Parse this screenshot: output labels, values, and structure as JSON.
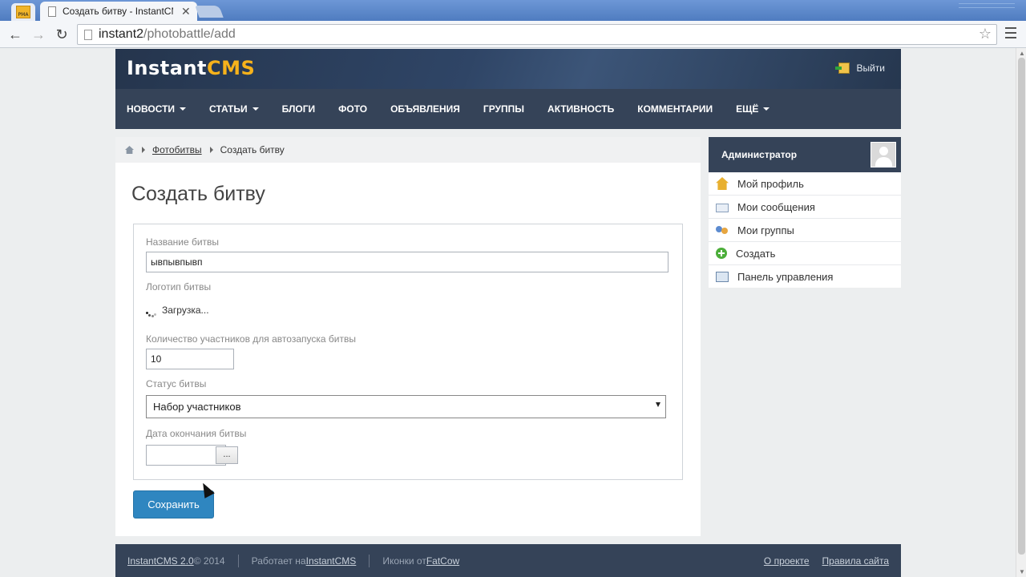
{
  "browser": {
    "tab_title": "Создать битву - InstantCMS",
    "tab_close": "✕",
    "url_host": "instant2",
    "url_path": "/photobattle/add",
    "app_icon_text": "PMA"
  },
  "site": {
    "logo_main": "Instant",
    "logo_accent": "CMS",
    "logout": "Выйти"
  },
  "nav": [
    {
      "label": "НОВОСТИ",
      "dropdown": true
    },
    {
      "label": "СТАТЬИ",
      "dropdown": true
    },
    {
      "label": "БЛОГИ",
      "dropdown": false
    },
    {
      "label": "ФОТО",
      "dropdown": false
    },
    {
      "label": "ОБЪЯВЛЕНИЯ",
      "dropdown": false
    },
    {
      "label": "ГРУППЫ",
      "dropdown": false
    },
    {
      "label": "АКТИВНОСТЬ",
      "dropdown": false
    },
    {
      "label": "КОММЕНТАРИИ",
      "dropdown": false
    },
    {
      "label": "ЕЩЁ",
      "dropdown": true
    }
  ],
  "breadcrumb": {
    "link": "Фотобитвы",
    "current": "Создать битву"
  },
  "page": {
    "title": "Создать битву"
  },
  "form": {
    "name_label": "Название битвы",
    "name_value": "ывпывпывп",
    "logo_label": "Логотип битвы",
    "loading_text": "Загрузка...",
    "count_label": "Количество участников для автозапуска битвы",
    "count_value": "10",
    "status_label": "Статус битвы",
    "status_value": "Набор участников",
    "date_label": "Дата окончания битвы",
    "date_value": "",
    "date_button": "...",
    "save_label": "Сохранить"
  },
  "user_menu": {
    "name": "Администратор",
    "items": [
      {
        "label": "Мой профиль",
        "icon": "home-icon"
      },
      {
        "label": "Мои сообщения",
        "icon": "mail-icon"
      },
      {
        "label": "Мои группы",
        "icon": "group-icon"
      },
      {
        "label": "Создать",
        "icon": "add-icon"
      },
      {
        "label": "Панель управления",
        "icon": "control-panel-icon"
      }
    ]
  },
  "footer": {
    "brand_link": "InstantCMS 2.0",
    "copyright": " © 2014",
    "powered_prefix": "Работает на ",
    "powered_link": "InstantCMS",
    "icons_prefix": "Иконки от ",
    "icons_link": "FatCow",
    "about_link": "О проекте",
    "rules_link": "Правила сайта"
  },
  "colors": {
    "header_bg": "#354358",
    "accent": "#2f86c0",
    "logo_accent": "#f7b21b"
  }
}
